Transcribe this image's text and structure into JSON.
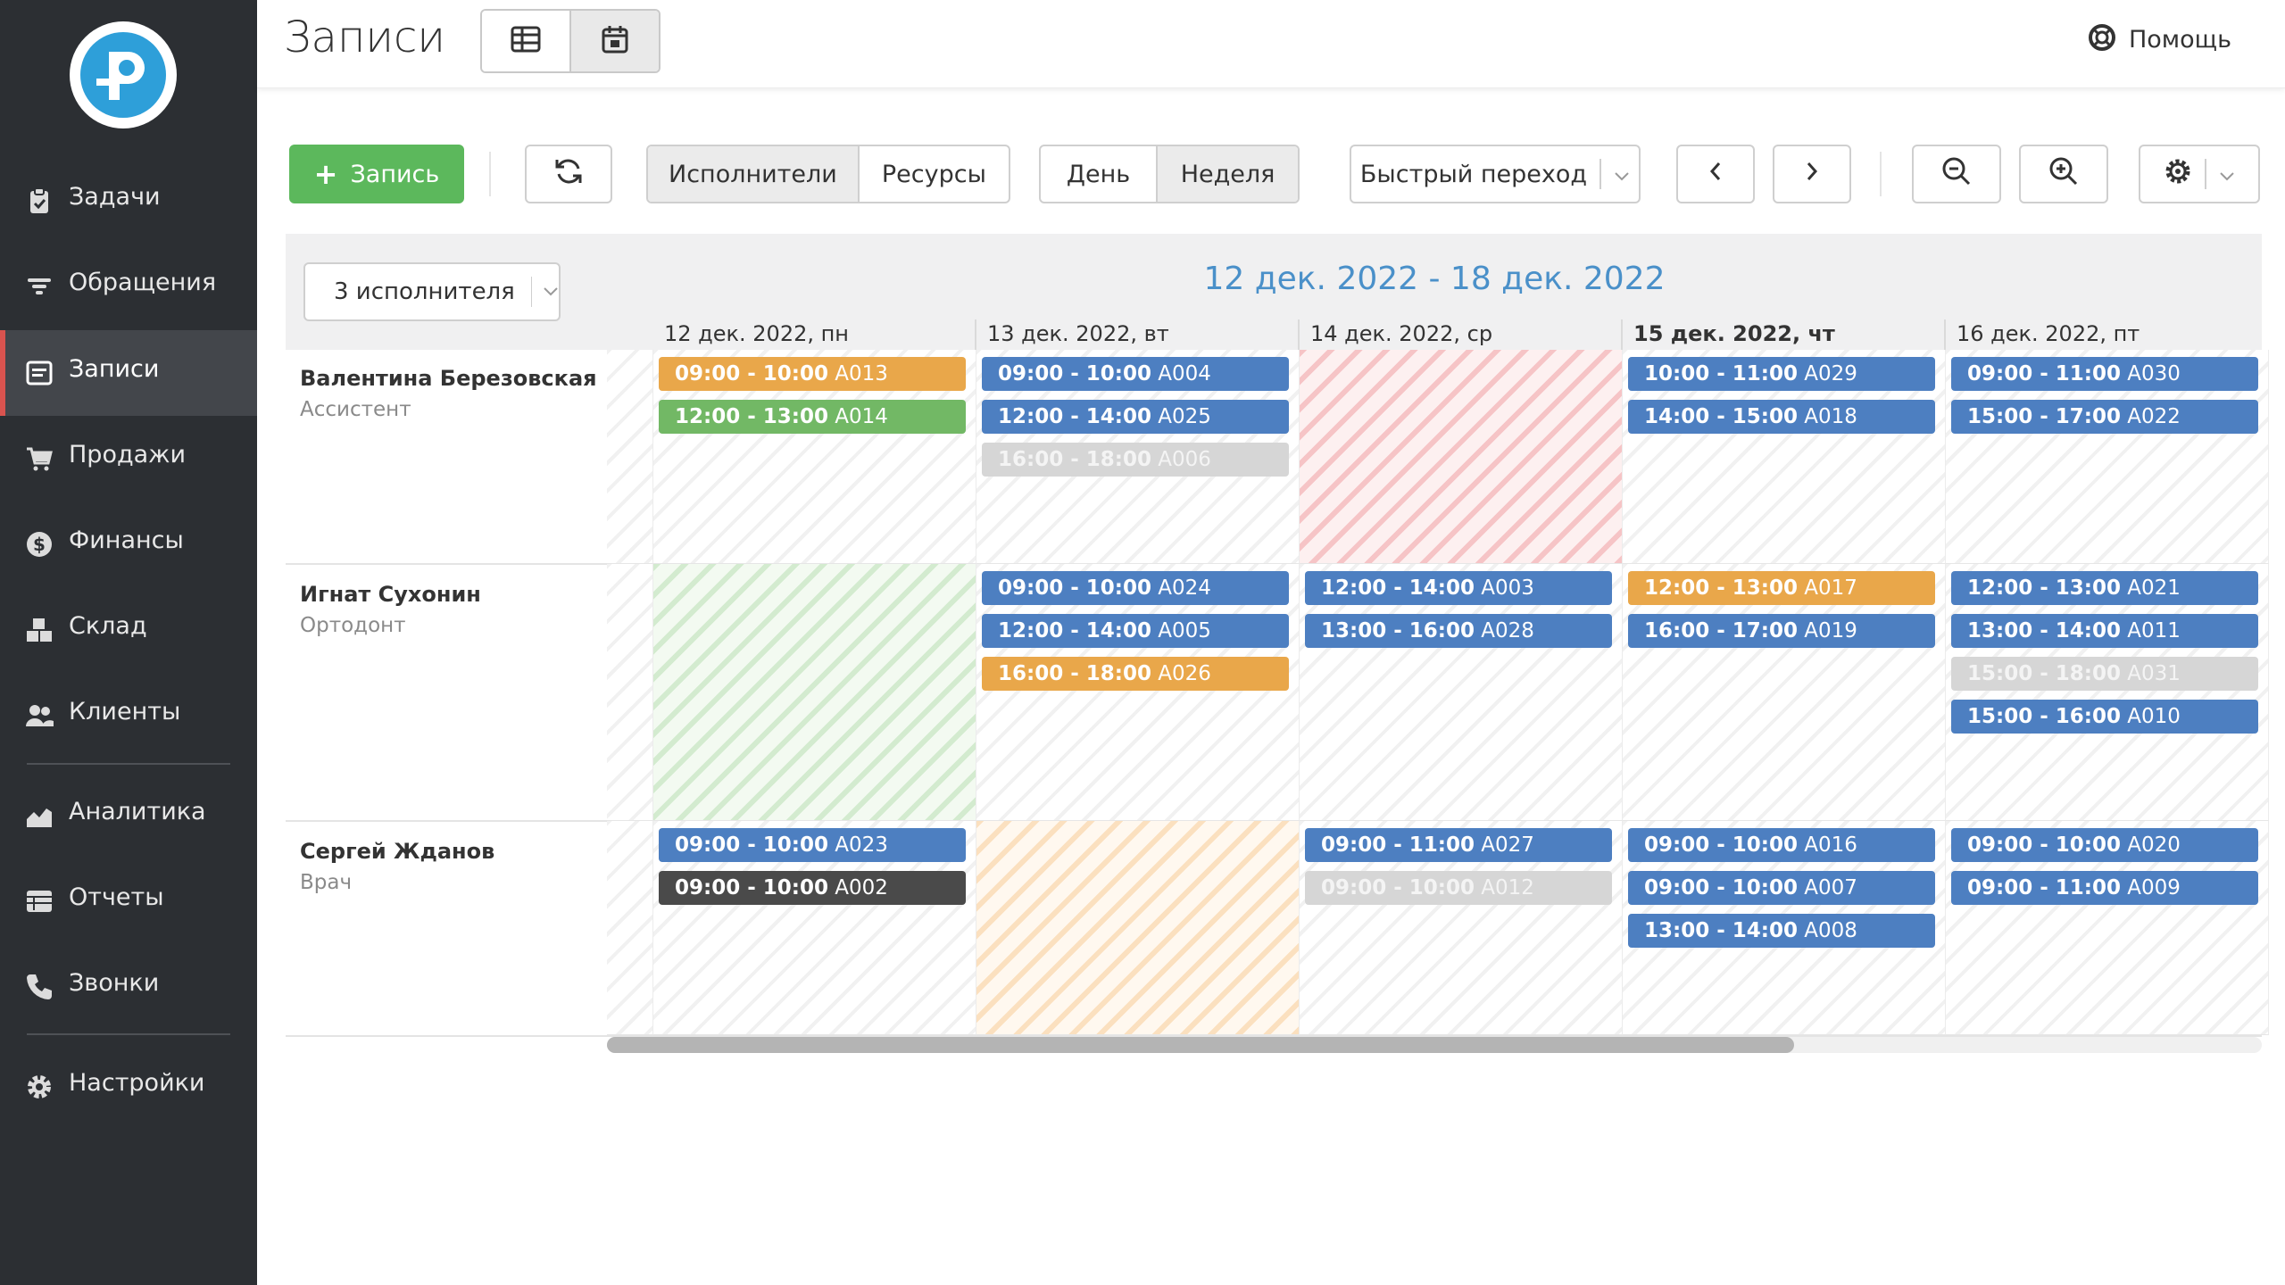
{
  "sidebar": {
    "items": [
      {
        "label": "Задачи",
        "icon": "clipboard-icon"
      },
      {
        "label": "Обращения",
        "icon": "filter-icon"
      },
      {
        "label": "Записи",
        "icon": "calendar-list-icon",
        "active": true
      },
      {
        "label": "Продажи",
        "icon": "cart-icon"
      },
      {
        "label": "Финансы",
        "icon": "dollar-icon"
      },
      {
        "label": "Склад",
        "icon": "boxes-icon"
      },
      {
        "label": "Клиенты",
        "icon": "users-icon"
      },
      {
        "label": "Аналитика",
        "icon": "chart-area-icon"
      },
      {
        "label": "Отчеты",
        "icon": "table-icon"
      },
      {
        "label": "Звонки",
        "icon": "phone-icon"
      },
      {
        "label": "Настройки",
        "icon": "gear-icon"
      }
    ]
  },
  "header": {
    "title": "Записи",
    "help": "Помощь"
  },
  "toolbar": {
    "add_label": "Запись",
    "mode": [
      "Исполнители",
      "Ресурсы"
    ],
    "range": [
      "День",
      "Неделя"
    ],
    "quick_jump": "Быстрый переход"
  },
  "calendar": {
    "filter": "3 исполнителя",
    "week_title": "12 дек. 2022 - 18 дек. 2022",
    "days": [
      "12 дек. 2022, пн",
      "13 дек. 2022, вт",
      "14 дек. 2022, ср",
      "15 дек. 2022, чт",
      "16 дек. 2022, пт"
    ],
    "today_index": 3,
    "rows": [
      {
        "name": "Валентина Березовская",
        "role": "Ассистент"
      },
      {
        "name": "Игнат Сухонин",
        "role": "Ортодонт"
      },
      {
        "name": "Сергей Жданов",
        "role": "Врач"
      }
    ],
    "appointments": [
      {
        "row": 0,
        "day": 0,
        "slot": 0,
        "time": "09:00 - 10:00",
        "code": "A013",
        "color": "orange"
      },
      {
        "row": 0,
        "day": 0,
        "slot": 1,
        "time": "12:00 - 13:00",
        "code": "A014",
        "color": "green"
      },
      {
        "row": 0,
        "day": 1,
        "slot": 0,
        "time": "09:00 - 10:00",
        "code": "A004",
        "color": "blue"
      },
      {
        "row": 0,
        "day": 1,
        "slot": 1,
        "time": "12:00 - 14:00",
        "code": "A025",
        "color": "blue"
      },
      {
        "row": 0,
        "day": 1,
        "slot": 2,
        "time": "16:00 - 18:00",
        "code": "A006",
        "color": "gray"
      },
      {
        "row": 0,
        "day": 3,
        "slot": 0,
        "time": "10:00 - 11:00",
        "code": "A029",
        "color": "blue"
      },
      {
        "row": 0,
        "day": 3,
        "slot": 1,
        "time": "14:00 - 15:00",
        "code": "A018",
        "color": "blue"
      },
      {
        "row": 0,
        "day": 4,
        "slot": 0,
        "time": "09:00 - 11:00",
        "code": "A030",
        "color": "blue"
      },
      {
        "row": 0,
        "day": 4,
        "slot": 1,
        "time": "15:00 - 17:00",
        "code": "A022",
        "color": "blue"
      },
      {
        "row": 1,
        "day": 1,
        "slot": 0,
        "time": "09:00 - 10:00",
        "code": "A024",
        "color": "blue"
      },
      {
        "row": 1,
        "day": 1,
        "slot": 1,
        "time": "12:00 - 14:00",
        "code": "A005",
        "color": "blue"
      },
      {
        "row": 1,
        "day": 1,
        "slot": 2,
        "time": "16:00 - 18:00",
        "code": "A026",
        "color": "orange"
      },
      {
        "row": 1,
        "day": 2,
        "slot": 0,
        "time": "12:00 - 14:00",
        "code": "A003",
        "color": "blue"
      },
      {
        "row": 1,
        "day": 2,
        "slot": 1,
        "time": "13:00 - 16:00",
        "code": "A028",
        "color": "blue"
      },
      {
        "row": 1,
        "day": 3,
        "slot": 0,
        "time": "12:00 - 13:00",
        "code": "A017",
        "color": "orange"
      },
      {
        "row": 1,
        "day": 3,
        "slot": 1,
        "time": "16:00 - 17:00",
        "code": "A019",
        "color": "blue"
      },
      {
        "row": 1,
        "day": 4,
        "slot": 0,
        "time": "12:00 - 13:00",
        "code": "A021",
        "color": "blue"
      },
      {
        "row": 1,
        "day": 4,
        "slot": 1,
        "time": "13:00 - 14:00",
        "code": "A011",
        "color": "blue"
      },
      {
        "row": 1,
        "day": 4,
        "slot": 2,
        "time": "15:00 - 18:00",
        "code": "A031",
        "color": "gray"
      },
      {
        "row": 1,
        "day": 4,
        "slot": 3,
        "time": "15:00 - 16:00",
        "code": "A010",
        "color": "blue"
      },
      {
        "row": 2,
        "day": 0,
        "slot": 0,
        "time": "09:00 - 10:00",
        "code": "A023",
        "color": "blue"
      },
      {
        "row": 2,
        "day": 0,
        "slot": 1,
        "time": "09:00 - 10:00",
        "code": "A002",
        "color": "dark"
      },
      {
        "row": 2,
        "day": 2,
        "slot": 0,
        "time": "09:00 - 11:00",
        "code": "A027",
        "color": "blue"
      },
      {
        "row": 2,
        "day": 2,
        "slot": 1,
        "time": "09:00 - 10:00",
        "code": "A012",
        "color": "gray"
      },
      {
        "row": 2,
        "day": 3,
        "slot": 0,
        "time": "09:00 - 10:00",
        "code": "A016",
        "color": "blue"
      },
      {
        "row": 2,
        "day": 3,
        "slot": 1,
        "time": "09:00 - 10:00",
        "code": "A007",
        "color": "blue"
      },
      {
        "row": 2,
        "day": 3,
        "slot": 2,
        "time": "13:00 - 14:00",
        "code": "A008",
        "color": "blue"
      },
      {
        "row": 2,
        "day": 4,
        "slot": 0,
        "time": "09:00 - 10:00",
        "code": "A020",
        "color": "blue"
      },
      {
        "row": 2,
        "day": 4,
        "slot": 1,
        "time": "09:00 - 11:00",
        "code": "A009",
        "color": "blue"
      }
    ],
    "highlights": [
      {
        "row": 0,
        "day": 2,
        "tone": "red"
      },
      {
        "row": 1,
        "day": 0,
        "tone": "green"
      },
      {
        "row": 2,
        "day": 1,
        "tone": "orange"
      }
    ]
  },
  "colors": {
    "sidebar_bg": "#2c2f33",
    "accent_active": "#d9534f",
    "primary_green": "#5cb85c",
    "appt_blue": "#4d7fc1",
    "appt_orange": "#e9a74a",
    "appt_green": "#72b865",
    "appt_gray": "#d6d6d6",
    "appt_dark": "#4a4a4a",
    "week_title": "#4a90c9"
  }
}
